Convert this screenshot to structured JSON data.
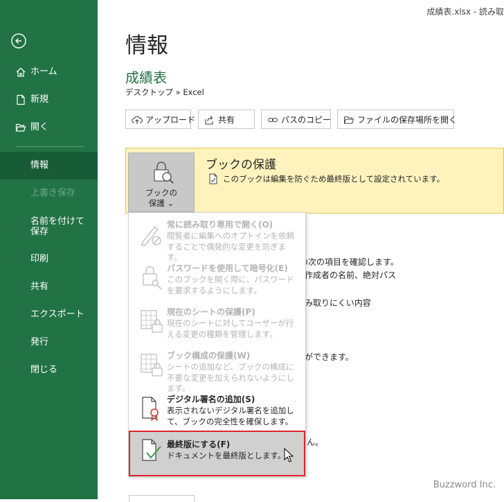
{
  "window": {
    "title": "成績表.xlsx  -  読み取"
  },
  "sidebar": {
    "items": [
      {
        "label": "ホーム"
      },
      {
        "label": "新規"
      },
      {
        "label": "開く"
      },
      {
        "label": "情報"
      },
      {
        "label": "上書き保存"
      },
      {
        "label": "名前を付けて保存"
      },
      {
        "label": "印刷"
      },
      {
        "label": "共有"
      },
      {
        "label": "エクスポート"
      },
      {
        "label": "発行"
      },
      {
        "label": "閉じる"
      }
    ]
  },
  "main": {
    "title": "情報",
    "book_name": "成績表",
    "path": "デスクトップ » Excel",
    "buttons": [
      {
        "label": "アップロード"
      },
      {
        "label": "共有"
      },
      {
        "label": "パスのコピー"
      },
      {
        "label": "ファイルの保存場所を開く"
      }
    ],
    "protect": {
      "button_label": "ブックの\n保護 ⌄",
      "title": "ブックの保護",
      "description": "このブックは編集を防ぐため最終版として設定されています。"
    },
    "background_fragments": [
      "ルの次の項目を確認します。",
      "作成者の名前、絶対パス",
      "み取りにくい内容",
      "ができます。",
      "ん。"
    ]
  },
  "menu": {
    "items": [
      {
        "title": "常に読み取り専用で開く(O)",
        "desc": "閲覧者に編集へのオプトインを依頼することで偶発的な変更を防ぎます。",
        "enabled": false
      },
      {
        "title": "パスワードを使用して暗号化(E)",
        "desc": "このブックを開く際に、パスワードを要求するようにします。",
        "enabled": false
      },
      {
        "title": "現在のシートの保護(P)",
        "desc": "現在のシートに対してユーザーが行える変更の種類を管理します。",
        "enabled": false
      },
      {
        "title": "ブック構成の保護(W)",
        "desc": "シートの追加など、ブックの構成に不要な変更を加えられないようにします。",
        "enabled": false
      },
      {
        "title": "デジタル署名の追加(S)",
        "desc": "表示されないデジタル署名を追加して、ブックの完全性を確保します。",
        "enabled": true
      },
      {
        "title": "最終版にする(F)",
        "desc": "ドキュメントを最終版とします。",
        "enabled": true
      }
    ]
  },
  "watermark": "Buzzword Inc.",
  "colors": {
    "sidebar": "#217346",
    "sidebar_selected": "#185c37",
    "accent_green": "#217346",
    "protect_bg": "#fff3bd",
    "highlight_border": "#e0242c"
  }
}
